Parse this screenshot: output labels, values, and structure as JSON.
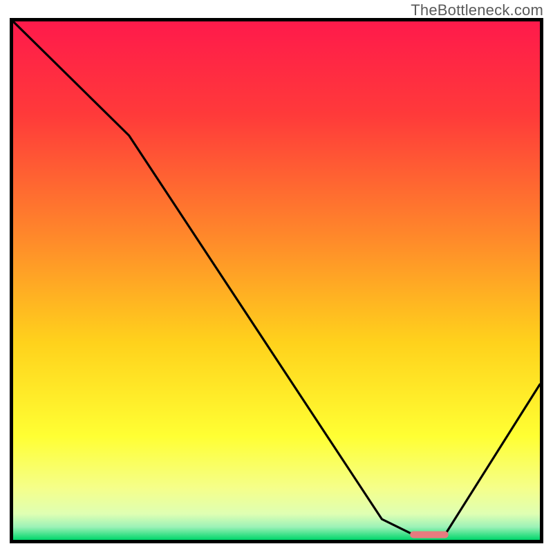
{
  "watermark": "TheBottleneck.com",
  "chart_data": {
    "type": "line",
    "title": "",
    "xlabel": "",
    "ylabel": "",
    "xlim": [
      0,
      100
    ],
    "ylim": [
      0,
      100
    ],
    "series": [
      {
        "name": "curve",
        "x": [
          0,
          22,
          70,
          76,
          82,
          100
        ],
        "values": [
          100,
          78,
          4,
          1,
          1,
          30
        ]
      }
    ],
    "marker": {
      "x": [
        76,
        82
      ],
      "y": 1,
      "color": "#e77b7f",
      "width": 10
    },
    "background_gradient": {
      "stops": [
        {
          "offset": 0.0,
          "color": "#ff1a4b"
        },
        {
          "offset": 0.18,
          "color": "#ff3a3a"
        },
        {
          "offset": 0.42,
          "color": "#ff8a2a"
        },
        {
          "offset": 0.62,
          "color": "#ffd21c"
        },
        {
          "offset": 0.8,
          "color": "#ffff33"
        },
        {
          "offset": 0.9,
          "color": "#f5ff8a"
        },
        {
          "offset": 0.95,
          "color": "#dfffb3"
        },
        {
          "offset": 0.975,
          "color": "#9cf2b7"
        },
        {
          "offset": 1.0,
          "color": "#00d66b"
        }
      ]
    }
  }
}
